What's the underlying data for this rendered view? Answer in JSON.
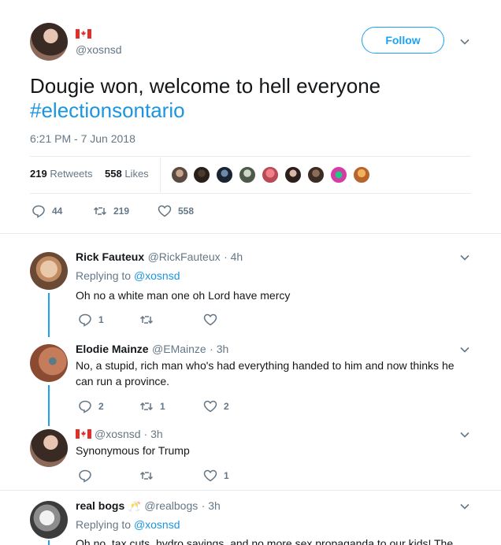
{
  "tweet": {
    "handle": "@xosnsd",
    "follow_label": "Follow",
    "text_line1": "Dougie won, welcome to hell everyone",
    "hashtag": "#electionsontario",
    "timestamp": "6:21 PM - 7 Jun 2018",
    "retweets_count": "219",
    "retweets_label": "Retweets",
    "likes_count": "558",
    "likes_label": "Likes",
    "actions": {
      "replies": "44",
      "retweets": "219",
      "likes": "558"
    }
  },
  "replies": [
    {
      "name": "Rick Fauteux",
      "handle": "@RickFauteux",
      "time": "· 4h",
      "replying_prefix": "Replying to",
      "replying_to": "@xosnsd",
      "text": "Oh no a white man one oh Lord have mercy",
      "counts": {
        "replies": "1",
        "retweets": "",
        "likes": ""
      }
    },
    {
      "name": "Elodie Mainze",
      "handle": "@EMainze",
      "time": "· 3h",
      "text_line1": "No, a stupid, rich man who's had everything handed to him and now thinks he",
      "text_line2": "can run a province.",
      "counts": {
        "replies": "2",
        "retweets": "1",
        "likes": "2"
      }
    },
    {
      "handle": "@xosnsd",
      "time": "· 3h",
      "text": "Synonymous for Trump",
      "counts": {
        "replies": "",
        "retweets": "",
        "likes": "1"
      }
    },
    {
      "name": "real bogs",
      "name_emoji": "🥂",
      "handle": "@realbogs",
      "time": "· 3h",
      "replying_prefix": "Replying to",
      "replying_to": "@xosnsd",
      "text": "Oh no, tax cuts, hydro savings, and no more sex propaganda to our kids! The"
    }
  ],
  "colors": {
    "accent": "#1da1f2",
    "link": "#1b95e0",
    "muted": "#657786",
    "text": "#14171a"
  }
}
